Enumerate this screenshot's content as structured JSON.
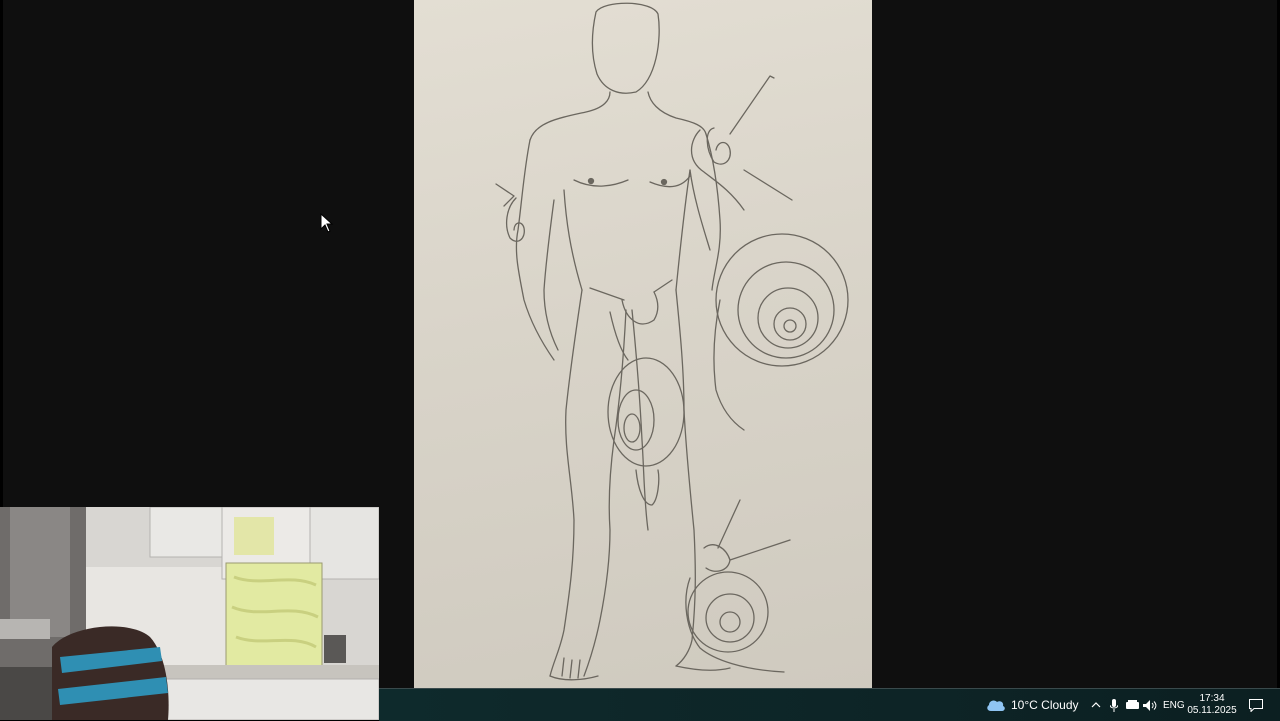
{
  "taskbar": {
    "weather": {
      "icon": "cloud-icon",
      "text": "10°C  Cloudy"
    },
    "tray": {
      "language": "ENG",
      "time": "17:34",
      "date": "05.11.2025"
    }
  },
  "colors": {
    "taskbar": "#0d2426",
    "viewer_background": "#0f0f0f",
    "paper": "#dcd7cc",
    "pencil": "#6b675f"
  }
}
